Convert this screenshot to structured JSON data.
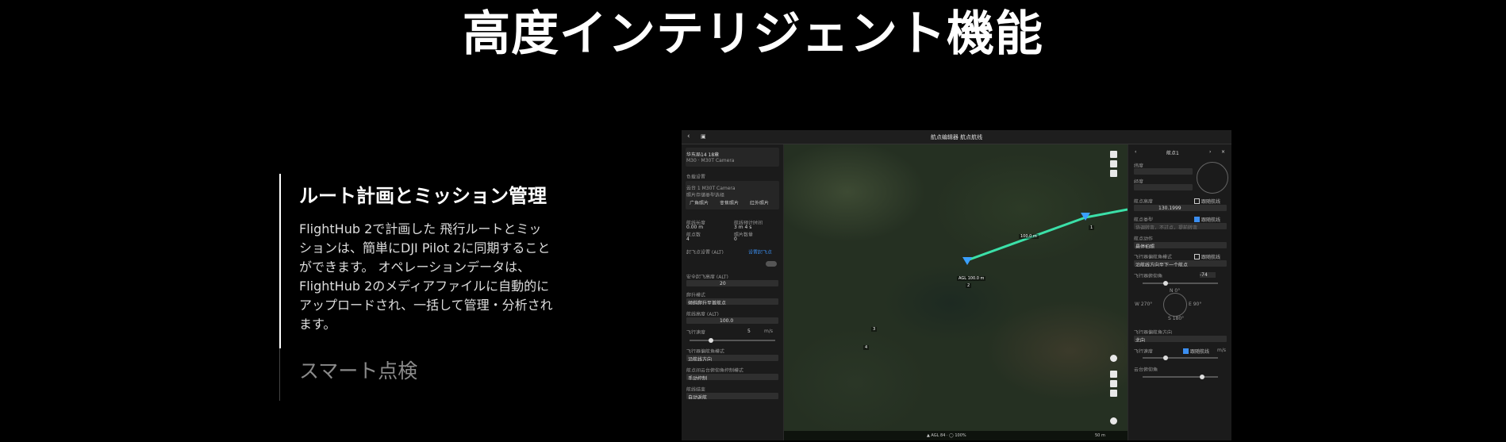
{
  "page": {
    "title": "高度インテリジェント機能"
  },
  "features": [
    {
      "heading": "ルート計画とミッション管理",
      "body": "FlightHub 2で計画した\n飛行ルートとミッションは、簡単にDJI Pilot 2に同期することができます。\nオペレーションデータは、FlightHub 2のメディアファイルに自動的にアップロードされ、一括して管理・分析されます。",
      "active": true
    },
    {
      "heading": "スマート点検",
      "active": false
    }
  ],
  "app": {
    "title": "航点编辑器 航点航线",
    "left_panel": {
      "route_name": "华东局14 18章",
      "device": "M30 · M30T Camera",
      "camera_section": "负载设置",
      "camera_name": "云台 1 M30T Camera",
      "photo_label": "照片存储类型选择",
      "photo_types": [
        "广角照片",
        "变焦照片",
        "红外照片"
      ],
      "stats": [
        {
          "label": "航线长度",
          "value": "0.00 m"
        },
        {
          "label": "航线预计时间",
          "value": "3 m 4 s"
        },
        {
          "label": "航点数",
          "value": "4"
        },
        {
          "label": "照片数量",
          "value": "0"
        }
      ],
      "takeoff_label": "起飞点设置 (ALT)",
      "takeoff_action": "设置起飞点",
      "safe_alt_label": "安全起飞高度 (ALT)",
      "safe_alt_value": "20",
      "climb_label": "爬升模式",
      "climb_value": "倾斜爬升至首航点",
      "route_alt_label": "航线高度 (ALT)",
      "route_alt_value": "100.0",
      "speed_label": "飞行速度",
      "speed_value": "5",
      "speed_unit": "m/s",
      "heading_label": "飞行器偏航角模式",
      "heading_value": "沿航线方向",
      "gimbal_label": "航点间云台俯仰角控制模式",
      "gimbal_value": "手动控制",
      "finish_label": "航线结束",
      "finish_value": "自动返航"
    },
    "map": {
      "wp_label_1": "AGL 100.0 m",
      "wp_label_2": "100.0 m",
      "waypoints": [
        "1",
        "2",
        "3",
        "4"
      ],
      "status_text": "▲ AGL 84 · ◯ 100%",
      "scale": "50 m"
    },
    "right_panel": {
      "header": "航点1",
      "lat_label": "纬度",
      "lon_label": "经度",
      "alt_label": "航点高度",
      "alt_value": "130.1999",
      "follow_label": "跟随航线",
      "type_label": "航点类型",
      "type_value": "协调转弯，不过点，提前转弯",
      "action_label": "航点动作",
      "action_value": "悬停拍照",
      "yaw_label": "飞行器偏航角模式",
      "yaw_value": "沿航线方向至下一个航点",
      "pitch_label": "飞行器俯仰角",
      "pitch_value": "-74",
      "heading_deg_n": "N 0°",
      "heading_deg_w": "W 270°",
      "heading_deg_e": "E 90°",
      "heading_deg_s": "S 180°",
      "mode_label": "飞行器偏航角方向",
      "mode_value": "北向",
      "speed_label": "飞行速度",
      "speed_follow": "跟随航线",
      "speed_unit": "m/s",
      "gimbal_label": "云台俯仰角"
    }
  }
}
